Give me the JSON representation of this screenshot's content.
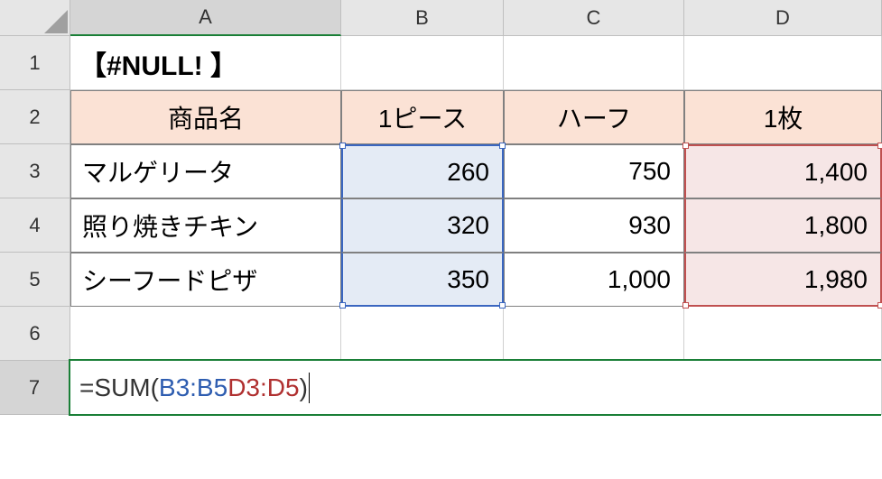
{
  "columns": [
    "A",
    "B",
    "C",
    "D"
  ],
  "rows": [
    "1",
    "2",
    "3",
    "4",
    "5",
    "6",
    "7"
  ],
  "title": "【#NULL! 】",
  "headers": {
    "a": "商品名",
    "b": "1ピース",
    "c": "ハーフ",
    "d": "1枚"
  },
  "data": [
    {
      "name": "マルゲリータ",
      "b": "260",
      "c": "750",
      "d": "1,400"
    },
    {
      "name": "照り焼きチキン",
      "b": "320",
      "c": "930",
      "d": "1,800"
    },
    {
      "name": "シーフードピザ",
      "b": "350",
      "c": "1,000",
      "d": "1,980"
    }
  ],
  "formula": {
    "prefix": "=SUM(",
    "range1": "B3:B5",
    "sep": " ",
    "range2": "D3:D5",
    "suffix": ")"
  },
  "active_cell": "A7",
  "selected_ranges": [
    "B3:B5",
    "D3:D5"
  ]
}
